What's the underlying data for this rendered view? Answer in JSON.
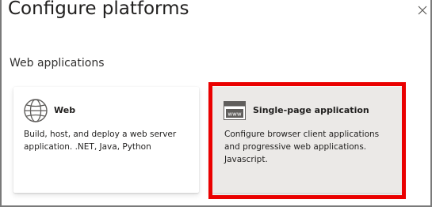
{
  "dialog": {
    "title": "Configure platforms",
    "close_icon": "close-icon"
  },
  "section": {
    "label": "Web applications"
  },
  "cards": [
    {
      "title": "Web",
      "icon": "globe-icon",
      "desc_line1": "Build, host, and deploy a web server",
      "desc_line2": "application. .NET, Java, Python"
    },
    {
      "title": "Single-page application",
      "icon": "browser-window-icon",
      "icon_text": "www",
      "desc_line1": "Configure browser client applications",
      "desc_line2": "and progressive web applications.",
      "desc_line3": "Javascript.",
      "highlight_color": "#ea0000"
    }
  ]
}
